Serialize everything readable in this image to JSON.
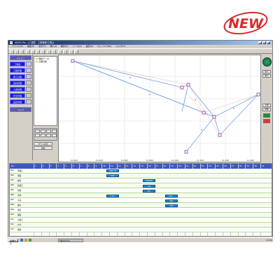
{
  "badge": {
    "text": "NEW",
    "color": "#d42a2a"
  },
  "window": {
    "title": "ANGO-Pro - [工程表 - 工程管理(工程)]",
    "controls": [
      "_",
      "□",
      "×"
    ]
  },
  "menu": [
    "ファイル(F)",
    "編集(E)",
    "表示(V)",
    "挿入(I)",
    "書式(O)",
    "ツール(T)",
    "設定(S)",
    "ウィンドウ(W)",
    "ヘルプ(H)"
  ],
  "nav": {
    "header": "メニュー",
    "items": [
      "工程表",
      "工程管理",
      "施工計画",
      "資材管理",
      "人員管理",
      "安全管理",
      "品質管理"
    ],
    "footer": "ヘルプ"
  },
  "tree": [
    "現場データ",
    "工程分析"
  ],
  "left_buttons": [
    "グラフ表示",
    "印刷"
  ],
  "chart": {
    "x_ticks": [
      "10.200",
      "10.400",
      "10.600",
      "10.800",
      "11.000",
      "11.200",
      "11.400",
      "11.600"
    ],
    "colors": {
      "network": "#7aa7e8",
      "nodes": "#8a3a8a",
      "dashed": "#e07b7b"
    }
  },
  "right_buttons": [
    "拡大",
    "縮小",
    "全体",
    "移動"
  ],
  "gantt": {
    "header_label": "No.",
    "columns": [
      "1",
      "2",
      "3",
      "4",
      "5",
      "6",
      "7",
      "8",
      "9",
      "10",
      "11",
      "12",
      "13",
      "14",
      "15",
      "16",
      "17",
      "18",
      "19",
      "20",
      "21",
      "22",
      "23",
      "24",
      "25",
      "26",
      "27",
      "28",
      "29",
      "30",
      "31"
    ],
    "rows": [
      {
        "no": "001",
        "name": "準備工"
      },
      {
        "no": "002",
        "name": "測量"
      },
      {
        "no": "003",
        "name": "掘削"
      },
      {
        "no": "004",
        "name": "基礎工"
      },
      {
        "no": "005",
        "name": "配筋"
      },
      {
        "no": "006",
        "name": "型枠"
      },
      {
        "no": "007",
        "name": "打設"
      },
      {
        "no": "008",
        "name": "養生"
      },
      {
        "no": "009",
        "name": "埋戻"
      },
      {
        "no": "010",
        "name": "舗装"
      },
      {
        "no": "011",
        "name": "付属工"
      },
      {
        "no": "012",
        "name": "片付"
      },
      {
        "no": "013",
        "name": "検査"
      }
    ],
    "tasks": [
      {
        "label": "基礎工事",
        "color": "#1e90d8"
      },
      {
        "label": "配筋",
        "color": "#1e90d8"
      },
      {
        "label": "型枠設置",
        "color": "#1e90d8"
      },
      {
        "label": "打設",
        "color": "#1e90d8"
      },
      {
        "label": "養生",
        "color": "#1e90d8"
      },
      {
        "label": "埋戻し",
        "color": "#1e90d8"
      },
      {
        "label": "舗装",
        "color": "#1e90d8"
      },
      {
        "label": "付属",
        "color": "#1e90d8"
      },
      {
        "label": "片付け",
        "color": "#1e90d8"
      }
    ]
  },
  "taskbar": {
    "start": "スタート",
    "task": "ANGO-Pro",
    "clock": "21:00"
  }
}
